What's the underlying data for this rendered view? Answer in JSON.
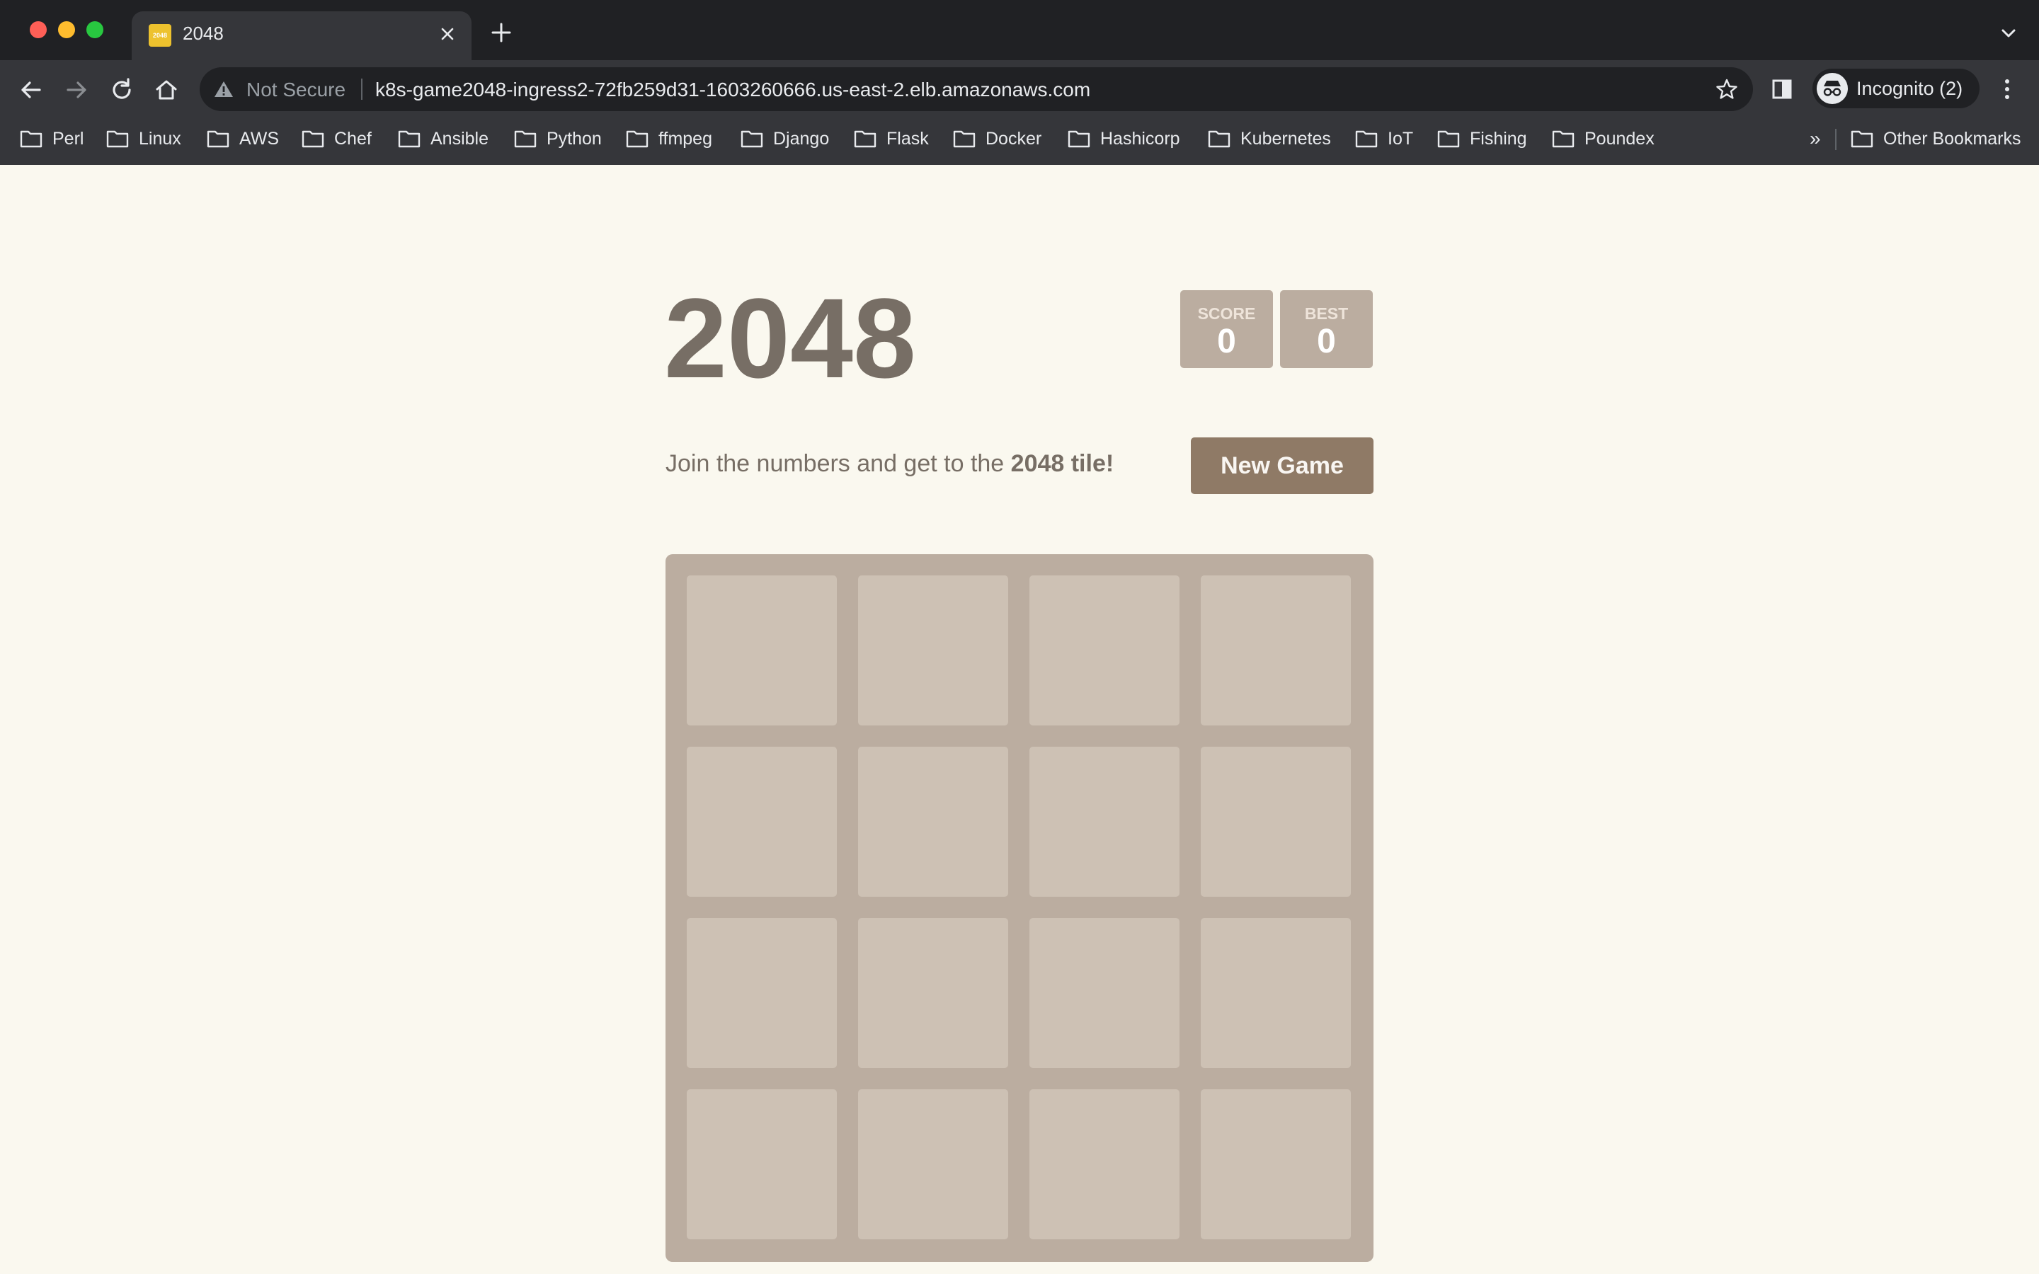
{
  "browser": {
    "tab": {
      "title": "2048",
      "favicon_text": "2048"
    },
    "address_bar": {
      "security_label": "Not Secure",
      "url": "k8s-game2048-ingress2-72fb259d31-1603260666.us-east-2.elb.amazonaws.com"
    },
    "profile": {
      "label": "Incognito (2)"
    },
    "bookmarks": [
      "Perl",
      "Linux",
      "AWS",
      "Chef",
      "Ansible",
      "Python",
      "ffmpeg",
      "Django",
      "Flask",
      "Docker",
      "Hashicorp",
      "Kubernetes",
      "IoT",
      "Fishing",
      "Poundex"
    ],
    "overflow_label": "»",
    "other_bookmarks": "Other Bookmarks",
    "icons": [
      "back-icon",
      "forward-icon",
      "reload-icon",
      "home-icon",
      "warning-icon",
      "star-icon",
      "side-panel-icon",
      "incognito-icon",
      "menu-icon",
      "close-icon",
      "plus-icon",
      "chevron-down-icon",
      "folder-icon"
    ]
  },
  "game": {
    "title": "2048",
    "score_label": "SCORE",
    "score_value": "0",
    "best_label": "BEST",
    "best_value": "0",
    "intro_prefix": "Join the numbers and get to the ",
    "intro_bold": "2048 tile!",
    "new_game_label": "New Game",
    "board": {
      "rows": 4,
      "cols": 4
    }
  },
  "colors": {
    "page_bg": "#faf8ef",
    "text": "#776e65",
    "board": "#bbada0",
    "cell": "#cdc1b4",
    "button": "#8f7a66"
  }
}
